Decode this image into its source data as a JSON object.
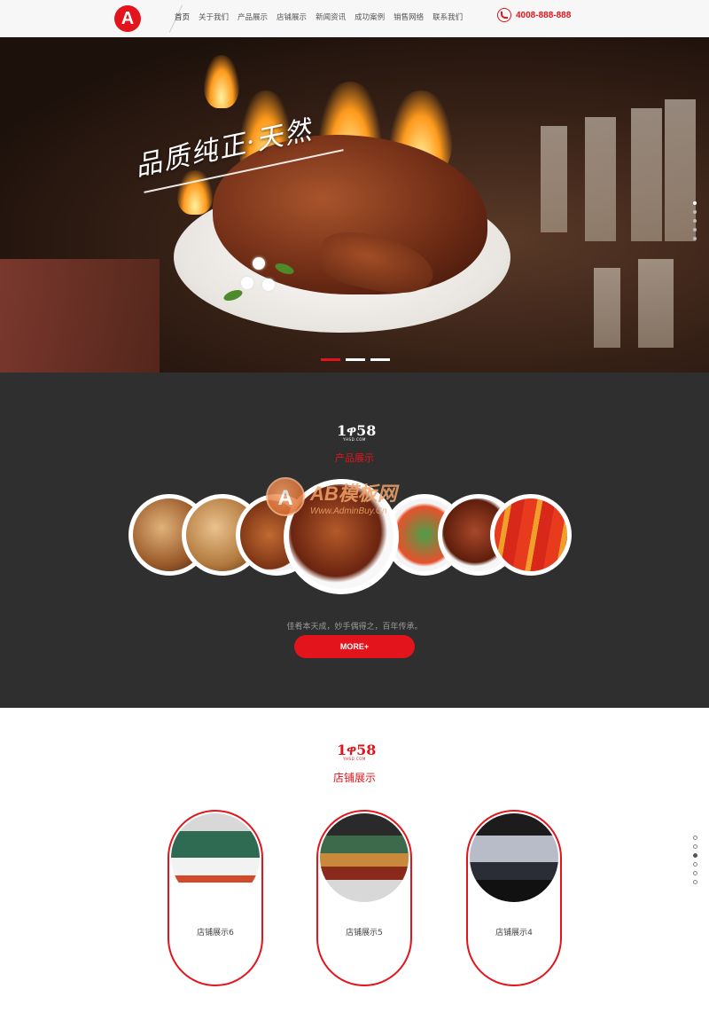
{
  "header": {
    "logo_letter": "A",
    "nav": [
      "首页",
      "关于我们",
      "产品展示",
      "店铺展示",
      "新闻资讯",
      "成功案例",
      "销售网络",
      "联系我们"
    ],
    "phone": "4008-888-888"
  },
  "banner": {
    "slogan": "品质纯正·天然",
    "slide_count": 3,
    "active_slide": 1
  },
  "products": {
    "brand_number": "1ዋ58",
    "brand_sub": "YHSD.COM",
    "title": "产品展示",
    "watermark_main": "AB模板网",
    "watermark_url": "Www.AdminBuy.Cn",
    "tagline": "佳肴本天成，妙手偶得之，百年传承。",
    "more_label": "MORE+"
  },
  "stores": {
    "brand_number": "1ዋ58",
    "brand_sub": "YHSD.COM",
    "title": "店铺展示",
    "items": [
      {
        "label": "店铺展示6"
      },
      {
        "label": "店铺展示5"
      },
      {
        "label": "店铺展示4"
      }
    ]
  },
  "colors": {
    "brand_red": "#e3141b",
    "dark_section": "#2f2f2f"
  }
}
